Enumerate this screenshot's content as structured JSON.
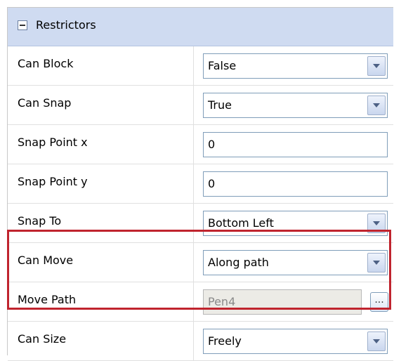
{
  "header": {
    "title": "Restrictors"
  },
  "rows": [
    {
      "label": "Can Block",
      "value": "False"
    },
    {
      "label": "Can Snap",
      "value": "True"
    },
    {
      "label": "Snap Point x",
      "value": "0"
    },
    {
      "label": "Snap Point y",
      "value": "0"
    },
    {
      "label": "Snap To",
      "value": "Bottom Left"
    },
    {
      "label": "Can Move",
      "value": "Along path"
    },
    {
      "label": "Move Path",
      "value": "Pen4",
      "button_label": "..."
    },
    {
      "label": "Can Size",
      "value": "Freely"
    }
  ],
  "colors": {
    "header_bg": "#cfdbf1",
    "highlight_border": "#c0242e"
  }
}
